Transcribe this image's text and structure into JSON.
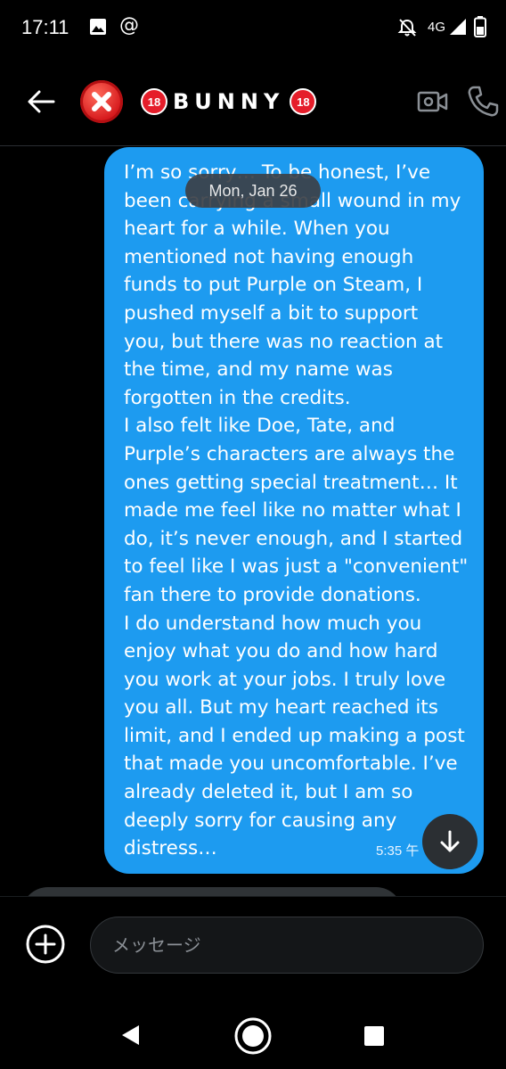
{
  "status_bar": {
    "time": "17:11",
    "network": "4G",
    "icons": [
      "gallery-icon",
      "at-icon",
      "mute-icon",
      "signal-icon",
      "battery-icon"
    ]
  },
  "header": {
    "contact_name": "BUNNY",
    "badge_text": "18",
    "icons": [
      "back-arrow-icon",
      "close-circle-icon",
      "video-call-icon",
      "phone-icon"
    ]
  },
  "date_separator": "Mon, Jan 26",
  "message": {
    "text": "I’m so sorry… To be honest, I’ve\nbeen carrying a small wound in my\nheart for a while. When you\nmentioned not having enough\nfunds to put Purple on Steam, I\npushed myself a bit to support\nyou, but there was no reaction at\nthe time, and my name was\nforgotten in the credits.\nI also felt like Doe, Tate, and\nPurple’s characters are always the\nones getting special treatment… It\nmade me feel like no matter what I\ndo, it’s never enough, and I started\nto feel like I was just a \"convenient\"\nfan there to provide donations.\nI do understand how much you\nenjoy what you do and how hard\nyou work at your jobs. I truly love\nyou all. But my heart reached its\nlimit, and I ended up making a post\nthat made you uncomfortable. I’ve\nalready deleted it, but I am so\ndeeply sorry for causing any\ndistress…",
    "timestamp": "5:35 午"
  },
  "composer": {
    "placeholder": "メッセージ"
  },
  "colors": {
    "bubble": "#1d9bf0",
    "background": "#000000",
    "badge_red": "#e51d2a"
  }
}
